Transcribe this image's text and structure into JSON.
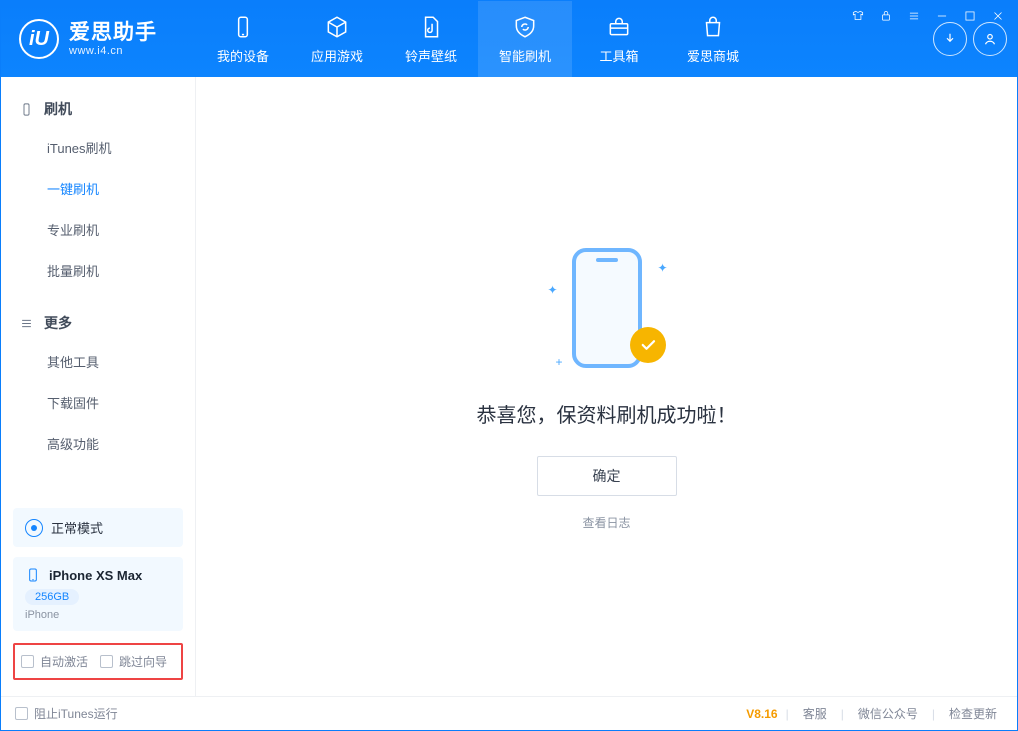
{
  "app": {
    "title": "爱思助手",
    "subtitle": "www.i4.cn"
  },
  "nav": {
    "items": [
      {
        "label": "我的设备"
      },
      {
        "label": "应用游戏"
      },
      {
        "label": "铃声壁纸"
      },
      {
        "label": "智能刷机"
      },
      {
        "label": "工具箱"
      },
      {
        "label": "爱思商城"
      }
    ]
  },
  "sidebar": {
    "section1": {
      "title": "刷机",
      "items": [
        "iTunes刷机",
        "一键刷机",
        "专业刷机",
        "批量刷机"
      ]
    },
    "section2": {
      "title": "更多",
      "items": [
        "其他工具",
        "下载固件",
        "高级功能"
      ]
    },
    "mode": "正常模式",
    "device": {
      "name": "iPhone XS Max",
      "storage": "256GB",
      "type": "iPhone"
    },
    "options": {
      "auto_activate": "自动激活",
      "skip_guide": "跳过向导"
    }
  },
  "main": {
    "success": "恭喜您，保资料刷机成功啦！",
    "ok": "确定",
    "view_log": "查看日志"
  },
  "status": {
    "block_itunes": "阻止iTunes运行",
    "version": "V8.16",
    "support": "客服",
    "wechat": "微信公众号",
    "update": "检查更新"
  }
}
